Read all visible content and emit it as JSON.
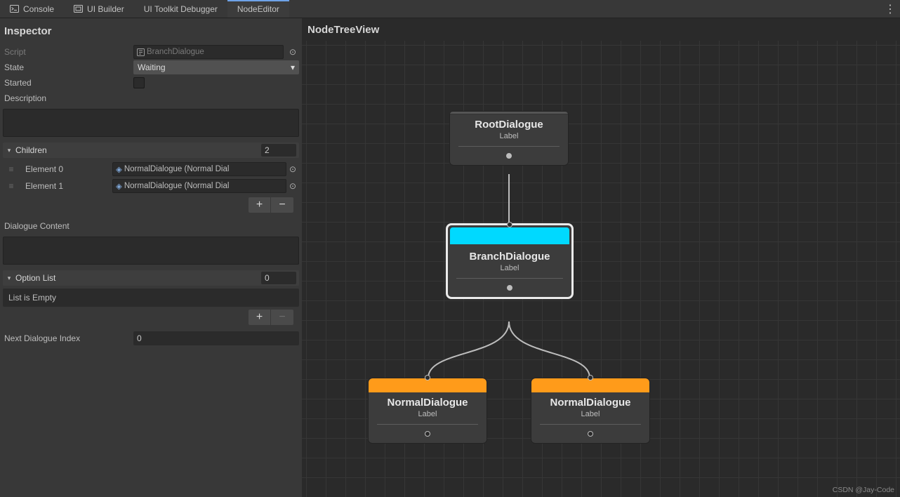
{
  "tabs": {
    "console": "Console",
    "ui_builder": "UI Builder",
    "ui_toolkit_debugger": "UI Toolkit Debugger",
    "node_editor": "NodeEditor"
  },
  "inspector": {
    "title": "Inspector",
    "script_label": "Script",
    "script_value": "BranchDialogue",
    "state_label": "State",
    "state_value": "Waiting",
    "started_label": "Started",
    "description_label": "Description",
    "children": {
      "header": "Children",
      "count": "2",
      "items": [
        {
          "label": "Element 0",
          "value": "NormalDialogue (Normal Dial"
        },
        {
          "label": "Element 1",
          "value": "NormalDialogue (Normal Dial"
        }
      ]
    },
    "dialogue_content_label": "Dialogue Content",
    "option_list": {
      "header": "Option List",
      "count": "0",
      "empty_text": "List is Empty"
    },
    "next_dialogue_index_label": "Next Dialogue Index",
    "next_dialogue_index_value": "0"
  },
  "treeview": {
    "title": "NodeTreeView",
    "nodes": {
      "root": {
        "title": "RootDialogue",
        "subtitle": "Label"
      },
      "branch": {
        "title": "BranchDialogue",
        "subtitle": "Label"
      },
      "n1": {
        "title": "NormalDialogue",
        "subtitle": "Label"
      },
      "n2": {
        "title": "NormalDialogue",
        "subtitle": "Label"
      }
    }
  },
  "watermark": "CSDN @Jay-Code",
  "glyphs": {
    "plus": "+",
    "minus": "−",
    "dropdown_arrow": "▾",
    "foldout_arrow": "▾",
    "target": "⊙",
    "drag": "≡",
    "vdots": "⋮"
  }
}
